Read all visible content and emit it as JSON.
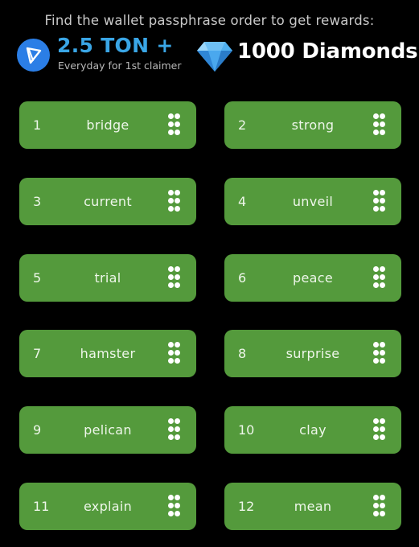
{
  "header": {
    "headline": "Find the wallet passphrase order to get rewards:",
    "rewards": {
      "ton": {
        "icon": "ton-logo-icon",
        "amount": "2.5 TON +",
        "subtitle": "Everyday for 1st claimer"
      },
      "diamonds": {
        "icon": "diamond-icon",
        "label": "1000 Diamonds"
      }
    }
  },
  "colors": {
    "background": "#000000",
    "card": "#549a3c",
    "ton_blue": "#2b7ee6",
    "ton_text": "#3aa6e6",
    "diamond": "#3b9be8"
  },
  "words": [
    {
      "num": "1",
      "word": "bridge"
    },
    {
      "num": "2",
      "word": "strong"
    },
    {
      "num": "3",
      "word": "current"
    },
    {
      "num": "4",
      "word": "unveil"
    },
    {
      "num": "5",
      "word": "trial"
    },
    {
      "num": "6",
      "word": "peace"
    },
    {
      "num": "7",
      "word": "hamster"
    },
    {
      "num": "8",
      "word": "surprise"
    },
    {
      "num": "9",
      "word": "pelican"
    },
    {
      "num": "10",
      "word": "clay"
    },
    {
      "num": "11",
      "word": "explain"
    },
    {
      "num": "12",
      "word": "mean"
    }
  ],
  "drag_handle_icon": "drag-handle-icon"
}
